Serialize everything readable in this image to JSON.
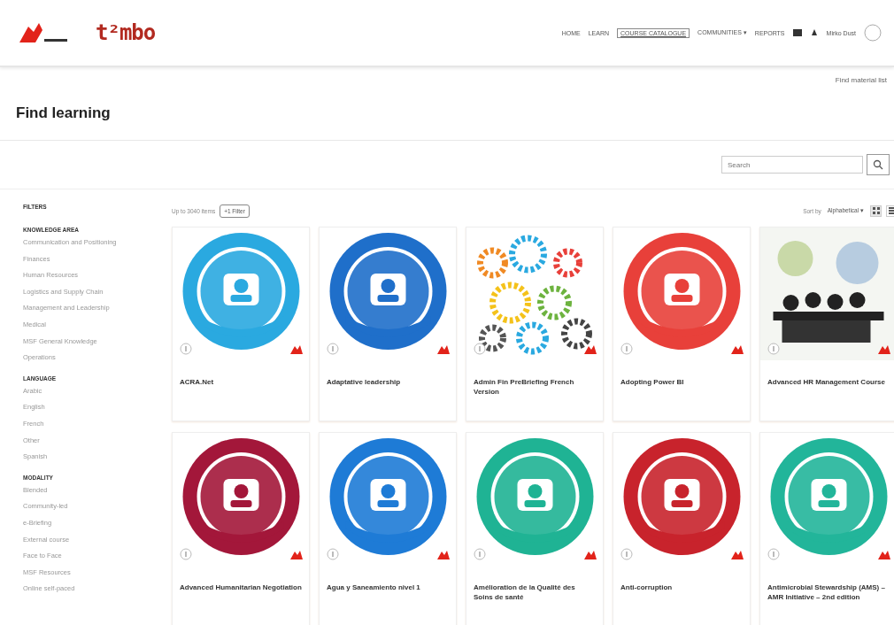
{
  "header": {
    "brand": "t²mbo",
    "nav": [
      {
        "label": "HOME",
        "selected": false
      },
      {
        "label": "LEARN",
        "selected": false
      },
      {
        "label": "COURSE CATALOGUE",
        "selected": true
      },
      {
        "label": "COMMUNITIES ▾",
        "selected": false
      },
      {
        "label": "REPORTS",
        "selected": false
      }
    ],
    "user": "Mirko Dust"
  },
  "top_link": "Find material list",
  "page_title": "Find learning",
  "search": {
    "placeholder": "Search"
  },
  "filters": {
    "title": "FILTERS",
    "groups": [
      {
        "title": "KNOWLEDGE AREA",
        "items": [
          "Communication and Positioning",
          "Finances",
          "Human Resources",
          "Logistics and Supply Chain",
          "Management and Leadership",
          "Medical",
          "MSF General Knowledge",
          "Operations"
        ]
      },
      {
        "title": "LANGUAGE",
        "items": [
          "Arabic",
          "English",
          "French",
          "Other",
          "Spanish"
        ]
      },
      {
        "title": "MODALITY",
        "items": [
          "Blended",
          "Community-led",
          "e-Briefing",
          "External course",
          "Face to Face",
          "MSF Resources",
          "Online self-paced"
        ]
      }
    ]
  },
  "results": {
    "count": "Up to 3040 items",
    "share_button": "+1 Filter",
    "sort_label": "Sort by",
    "sort_value": "Alphabetical ▾",
    "view_buttons": [
      {
        "kind": "grid",
        "selected": true
      },
      {
        "kind": "list",
        "selected": false
      }
    ]
  },
  "courses": [
    {
      "title": "ACRA.Net"
    },
    {
      "title": "Adaptative leadership"
    },
    {
      "title": "Admin Fin PreBriefing French Version"
    },
    {
      "title": "Adopting Power BI"
    },
    {
      "title": "Advanced HR Management Course"
    },
    {
      "title": "Advanced Humanitarian Negotiation"
    },
    {
      "title": "Agua y Saneamiento nivel 1"
    },
    {
      "title": "Amélioration de la Qualité des Soins de santé"
    },
    {
      "title": "Anti-corruption"
    },
    {
      "title": "Antimicrobial Stewardship (AMS) – AMR Initiative – 2nd edition"
    }
  ]
}
